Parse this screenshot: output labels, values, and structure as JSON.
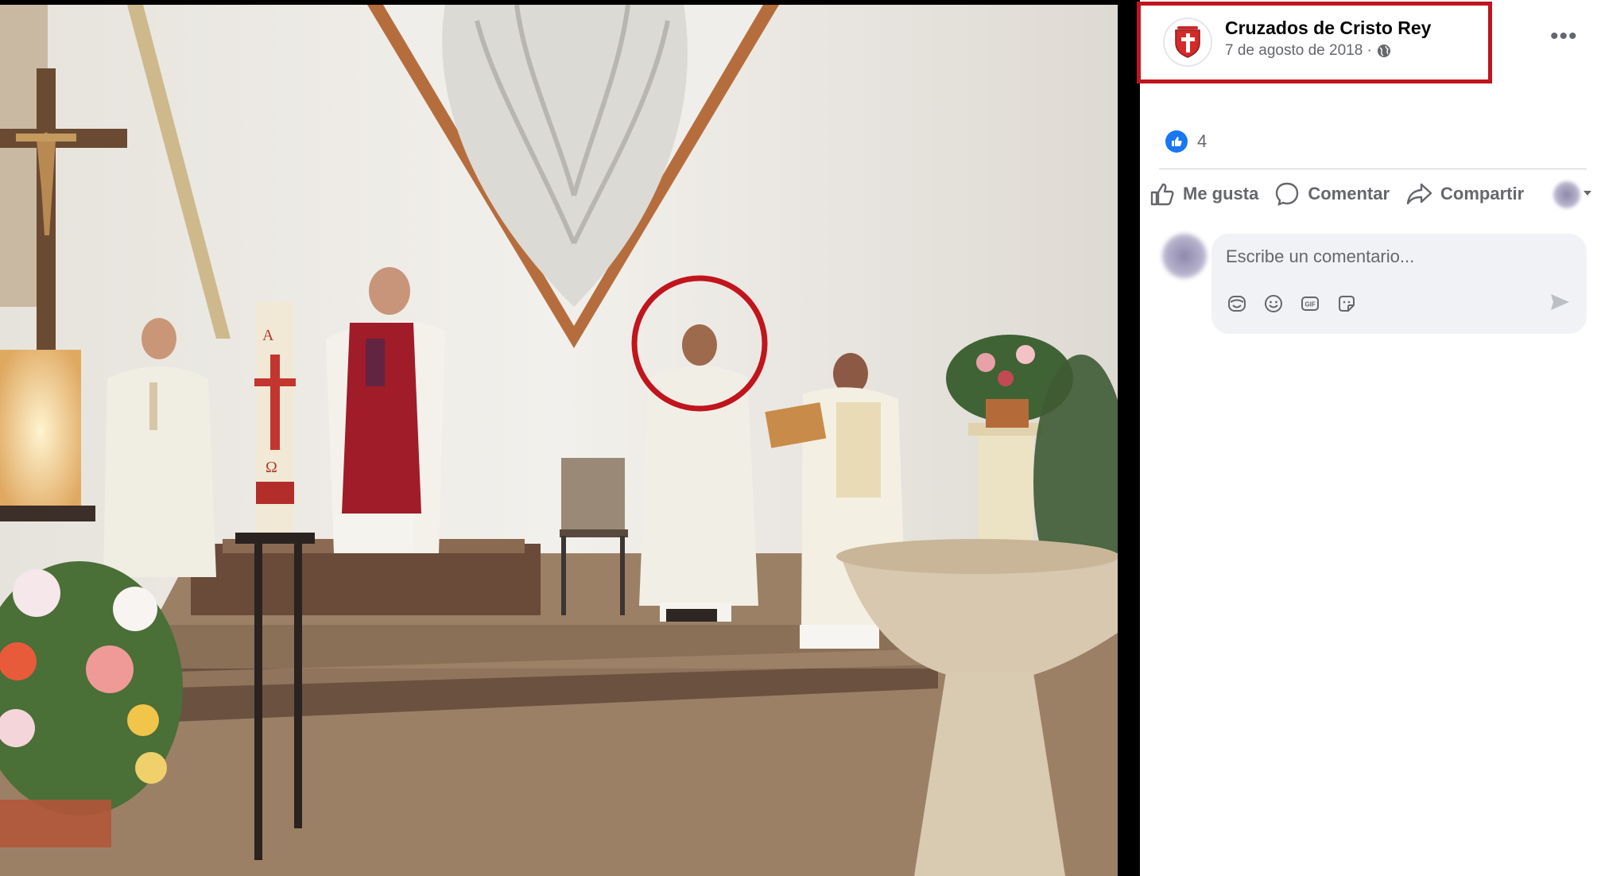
{
  "post": {
    "page_name": "Cruzados de Cristo Rey",
    "date": "7 de agosto de 2018 ·",
    "more_label": "•••",
    "reaction_count": "4"
  },
  "actions": {
    "like": "Me gusta",
    "comment": "Comentar",
    "share": "Compartir"
  },
  "comment": {
    "placeholder": "Escribe un comentario...",
    "icons": [
      "avatar-sticker-icon",
      "emoji-icon",
      "gif-icon",
      "sticker-icon"
    ]
  },
  "photo": {
    "candle_letters": [
      "A",
      "Ω"
    ]
  },
  "colors": {
    "highlight": "#c0151d",
    "like_blue": "#1877f2",
    "text_secondary": "#65676b"
  }
}
